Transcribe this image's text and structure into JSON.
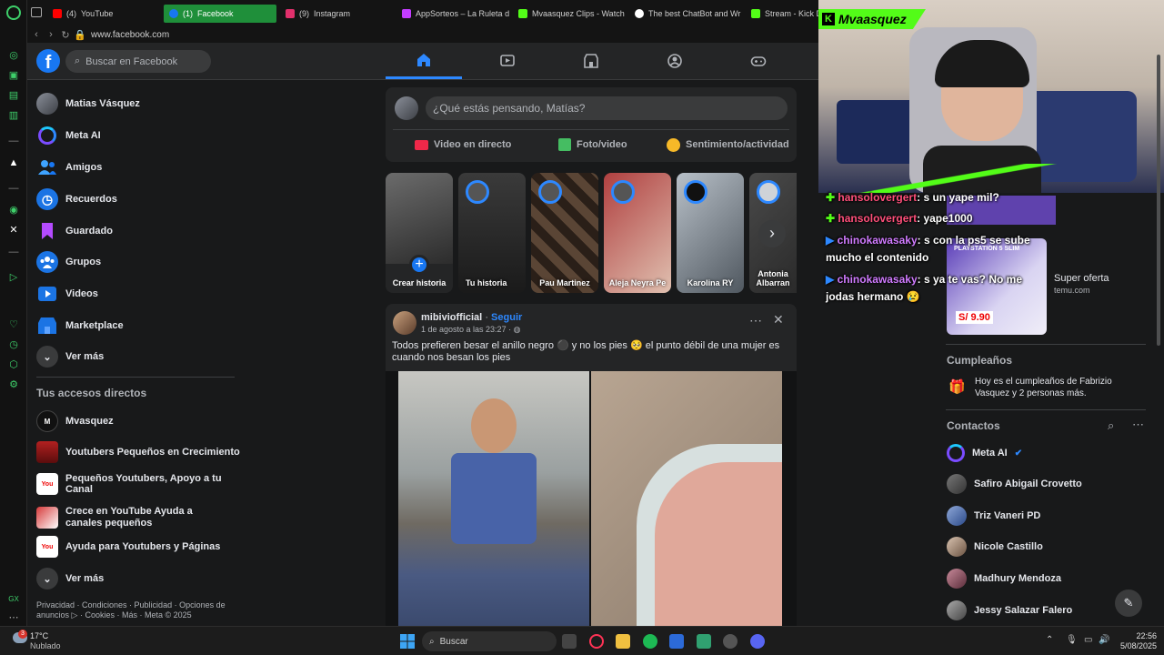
{
  "browser": {
    "tabs": [
      {
        "label": "YouTube",
        "badge": "(4)",
        "color": "#ff0000"
      },
      {
        "label": "Facebook",
        "badge": "(1)",
        "color": "#1877f2",
        "active": true
      },
      {
        "label": "Instagram",
        "badge": "(9)",
        "color": "#e1306c"
      },
      {
        "label": "AppSorteos – La Ruleta d",
        "badge": "",
        "color": "#c33cff"
      },
      {
        "label": "Mvaasquez Clips - Watch",
        "badge": "",
        "color": "#53fc18"
      },
      {
        "label": "The best ChatBot and Wr",
        "badge": "",
        "color": "#ffffff"
      },
      {
        "label": "Stream - Kick D",
        "badge": "",
        "color": "#53fc18"
      }
    ],
    "url": "www.facebook.com"
  },
  "fb": {
    "search_placeholder": "Buscar en Facebook",
    "left_menu": [
      {
        "label": "Matias Vásquez",
        "icon": "avatar"
      },
      {
        "label": "Meta AI",
        "icon": "meta-ai-icon"
      },
      {
        "label": "Amigos",
        "icon": "friends-icon"
      },
      {
        "label": "Recuerdos",
        "icon": "memories-icon"
      },
      {
        "label": "Guardado",
        "icon": "saved-icon"
      },
      {
        "label": "Grupos",
        "icon": "groups-icon"
      },
      {
        "label": "Videos",
        "icon": "video-icon"
      },
      {
        "label": "Marketplace",
        "icon": "marketplace-icon"
      },
      {
        "label": "Ver más",
        "icon": "chevron-down-icon"
      }
    ],
    "shortcuts_title": "Tus accesos directos",
    "shortcuts": [
      {
        "label": "Mvasquez"
      },
      {
        "label": "Youtubers Pequeños en Crecimiento"
      },
      {
        "label": "Pequeños Youtubers, Apoyo a tu Canal"
      },
      {
        "label": "Crece en YouTube Ayuda a canales pequeños"
      },
      {
        "label": "Ayuda para Youtubers y Páginas"
      },
      {
        "label": "Ver más"
      }
    ],
    "footer": "Privacidad · Condiciones · Publicidad · Opciones de anuncios ▷ · Cookies · Más · Meta © 2025",
    "composer": {
      "placeholder": "¿Qué estás pensando, Matías?",
      "live": "Video en directo",
      "photo": "Foto/video",
      "feeling": "Sentimiento/actividad"
    },
    "stories": [
      {
        "name": "Crear historia"
      },
      {
        "name": "Tu historia"
      },
      {
        "name": "Pau Martinez"
      },
      {
        "name": "Aleja Neyra Pe"
      },
      {
        "name": "Karolina RY"
      },
      {
        "name": "Antonia Albarran"
      }
    ],
    "post": {
      "author": "mibiviofficial",
      "follow": "Seguir",
      "time": "1 de agosto a las 23:27 · ",
      "text": "Todos prefieren besar el anillo negro ⚫ y no los pies 🥺 el punto  débil de una mujer es cuando nos besan los pies"
    },
    "ad": {
      "title": "Super oferta",
      "domain": "temu.com",
      "price": "S/ 9.90",
      "product": "PLAYSTATION 5 SLIM"
    },
    "birthdays_title": "Cumpleaños",
    "birthday_text": "Hoy es el cumpleaños de Fabrizio Vasquez y 2 personas más.",
    "contacts_title": "Contactos",
    "contacts": [
      {
        "name": "Meta AI"
      },
      {
        "name": "Safiro Abigail Crovetto"
      },
      {
        "name": "Triz Vaneri PD"
      },
      {
        "name": "Nicole Castillo"
      },
      {
        "name": "Madhury Mendoza"
      },
      {
        "name": "Jessy Salazar Falero"
      }
    ]
  },
  "stream": {
    "channel": "Mvaasquez",
    "chat": [
      {
        "user": "hansolovergert",
        "msg": ": s un yape mil?"
      },
      {
        "user": "hansolovergert",
        "msg": ": yape1000"
      },
      {
        "user": "chinokawasaky",
        "msg": ": s con la ps5 se sube"
      },
      {
        "user": "",
        "msg": "mucho el contenido"
      },
      {
        "user": "chinokawasaky",
        "msg": ": s ya te vas? No me"
      },
      {
        "user": "",
        "msg": "jodas hermano 😢"
      }
    ]
  },
  "taskbar": {
    "temp": "17°C",
    "weather": "Nublado",
    "weather_badge": "3",
    "search": "Buscar",
    "time": "22:56",
    "date": "5/08/2025"
  }
}
